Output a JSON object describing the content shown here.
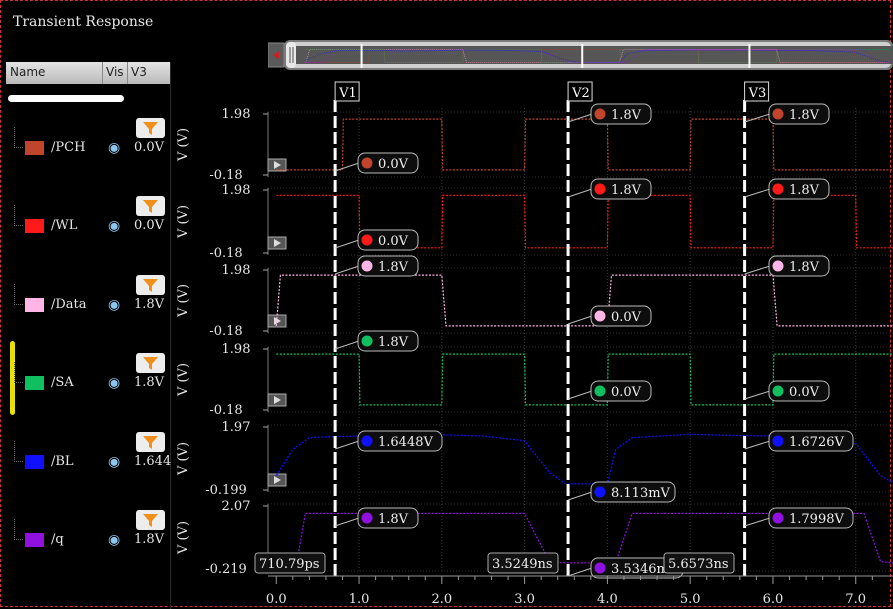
{
  "window_title": "Transient Response",
  "columns": {
    "name": "Name",
    "vis": "Vis",
    "v3": "V3"
  },
  "signals": [
    {
      "name": "/PCH",
      "color": "#c0452c",
      "v3": "0.0V"
    },
    {
      "name": "/WL",
      "color": "#ff1a1a",
      "v3": "0.0V"
    },
    {
      "name": "/Data",
      "color": "#ffb6e6",
      "v3": "1.8V"
    },
    {
      "name": "/SA",
      "color": "#10c060",
      "v3": "1.8V"
    },
    {
      "name": "/BL",
      "color": "#1010ff",
      "v3": "1.644"
    },
    {
      "name": "/q",
      "color": "#9010e0",
      "v3": "1.8V"
    }
  ],
  "chart_data": {
    "type": "line",
    "x_unit": "ns",
    "xlim": [
      -0.1,
      7.45
    ],
    "x_ticks": [
      "0.0",
      "1.0",
      "2.0",
      "3.0",
      "4.0",
      "5.0",
      "6.0",
      "7.0"
    ],
    "ylabel": "V (V)",
    "cursors": [
      {
        "label": "V1",
        "x": 0.7108,
        "x_label": "710.79ps"
      },
      {
        "label": "V2",
        "x": 3.5249,
        "x_label": "3.5249ns"
      },
      {
        "label": "V3",
        "x": 5.6573,
        "x_label": "5.6573ns"
      }
    ],
    "strips": [
      {
        "signal": "/PCH",
        "ylim": [
          -0.18,
          1.98
        ],
        "y_ticks": [
          "1.98",
          "-0.18"
        ],
        "points": [
          [
            0,
            0
          ],
          [
            0.8,
            0
          ],
          [
            0.81,
            1.8
          ],
          [
            2.0,
            1.8
          ],
          [
            2.01,
            0
          ],
          [
            3.0,
            0
          ],
          [
            3.01,
            1.8
          ],
          [
            4.0,
            1.8
          ],
          [
            4.01,
            0
          ],
          [
            5.0,
            0
          ],
          [
            5.01,
            1.8
          ],
          [
            6.0,
            1.8
          ],
          [
            6.01,
            0
          ],
          [
            7.45,
            0
          ]
        ],
        "markers": [
          "0.0V",
          "1.8V",
          "1.8V"
        ]
      },
      {
        "signal": "/WL",
        "ylim": [
          -0.18,
          1.98
        ],
        "y_ticks": [
          "1.98",
          "-0.18"
        ],
        "points": [
          [
            0,
            1.8
          ],
          [
            1.0,
            1.8
          ],
          [
            1.01,
            0
          ],
          [
            2.0,
            0
          ],
          [
            2.01,
            1.8
          ],
          [
            3.0,
            1.8
          ],
          [
            3.01,
            0
          ],
          [
            4.0,
            0
          ],
          [
            4.01,
            1.8
          ],
          [
            5.0,
            1.8
          ],
          [
            5.01,
            0
          ],
          [
            6.0,
            0
          ],
          [
            6.01,
            1.8
          ],
          [
            7.0,
            1.8
          ],
          [
            7.01,
            0
          ],
          [
            7.45,
            0
          ]
        ],
        "markers": [
          "0.0V",
          "1.8V",
          "1.8V"
        ]
      },
      {
        "signal": "/Data",
        "ylim": [
          -0.18,
          1.98
        ],
        "y_ticks": [
          "1.98",
          "-0.18"
        ],
        "points": [
          [
            0,
            0
          ],
          [
            0.05,
            1.8
          ],
          [
            2.0,
            1.8
          ],
          [
            2.05,
            0
          ],
          [
            4.0,
            0
          ],
          [
            4.05,
            1.8
          ],
          [
            6.0,
            1.8
          ],
          [
            6.05,
            0
          ],
          [
            7.45,
            0
          ]
        ],
        "markers": [
          "1.8V",
          "0.0V",
          "1.8V"
        ]
      },
      {
        "signal": "/SA",
        "ylim": [
          -0.18,
          1.98
        ],
        "y_ticks": [
          "1.98",
          "-0.18"
        ],
        "points": [
          [
            0,
            1.8
          ],
          [
            1.0,
            1.8
          ],
          [
            1.01,
            0
          ],
          [
            2.0,
            0
          ],
          [
            2.01,
            1.8
          ],
          [
            3.0,
            1.8
          ],
          [
            3.01,
            0
          ],
          [
            4.0,
            0
          ],
          [
            4.01,
            1.8
          ],
          [
            5.0,
            1.8
          ],
          [
            5.01,
            0
          ],
          [
            6.0,
            0
          ],
          [
            6.01,
            1.8
          ],
          [
            7.45,
            1.8
          ]
        ],
        "markers": [
          "1.8V",
          "0.0V",
          "0.0V"
        ]
      },
      {
        "signal": "/BL",
        "ylim": [
          -0.199,
          1.97
        ],
        "y_ticks": [
          "1.97",
          "-0.199"
        ],
        "points": [
          [
            0,
            0.3
          ],
          [
            0.2,
            1.2
          ],
          [
            0.4,
            1.6
          ],
          [
            0.7,
            1.64
          ],
          [
            1.0,
            1.66
          ],
          [
            1.2,
            1.55
          ],
          [
            1.5,
            1.58
          ],
          [
            2.0,
            1.7
          ],
          [
            2.5,
            1.66
          ],
          [
            3.0,
            1.5
          ],
          [
            3.3,
            0.4
          ],
          [
            3.5,
            0.01
          ],
          [
            4.0,
            0.01
          ],
          [
            4.1,
            1.2
          ],
          [
            4.3,
            1.6
          ],
          [
            5.0,
            1.72
          ],
          [
            5.5,
            1.68
          ],
          [
            6.0,
            1.66
          ],
          [
            6.5,
            1.6
          ],
          [
            7.0,
            1.4
          ],
          [
            7.3,
            0.3
          ],
          [
            7.45,
            0.05
          ]
        ],
        "markers": [
          "1.6448V",
          "8.113mV",
          "1.6726V"
        ]
      },
      {
        "signal": "/q",
        "ylim": [
          -0.219,
          2.07
        ],
        "y_ticks": [
          "2.07",
          "-0.219"
        ],
        "points": [
          [
            0,
            0
          ],
          [
            0.25,
            0.05
          ],
          [
            0.35,
            1.8
          ],
          [
            3.0,
            1.8
          ],
          [
            3.3,
            0.05
          ],
          [
            3.5,
            0.0035
          ],
          [
            4.1,
            0.0035
          ],
          [
            4.3,
            1.8
          ],
          [
            7.1,
            1.8
          ],
          [
            7.3,
            0.05
          ],
          [
            7.45,
            0
          ]
        ],
        "markers": [
          "1.8V",
          "3.5346mV",
          "1.7998V"
        ]
      }
    ]
  }
}
